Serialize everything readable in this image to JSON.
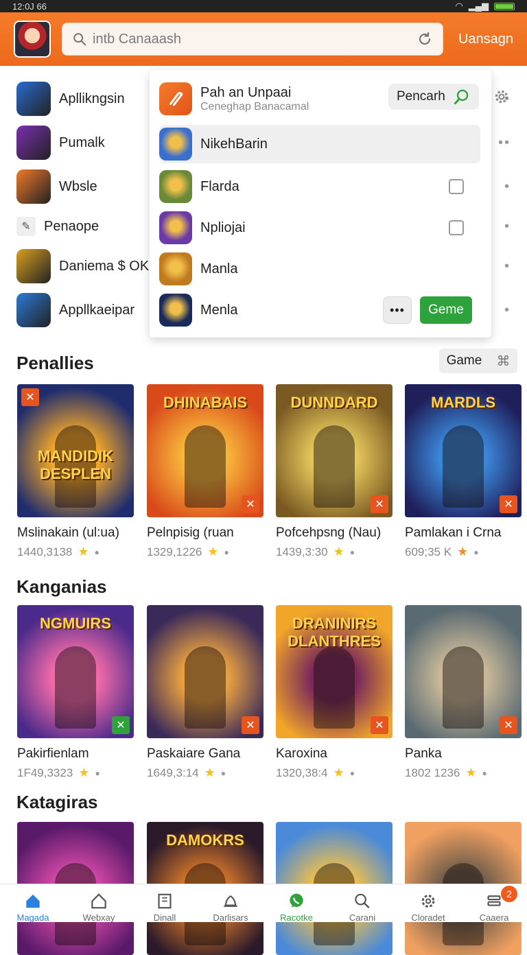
{
  "status": {
    "time": "12:0J 66"
  },
  "header": {
    "search_value": "intb Canaaash",
    "signin_label": "Uansagn"
  },
  "app_list": [
    {
      "label": "Apllikngsin",
      "icon": "wizard-app-icon",
      "color": "#2a6bd1"
    },
    {
      "label": "Pumalk",
      "icon": "game-app-icon",
      "color": "#7a2fb0"
    },
    {
      "label": "Wbsle",
      "icon": "mail-app-icon",
      "color": "#f07a2a"
    },
    {
      "label": "Penaope",
      "icon": "pencil-icon",
      "color": "#eeeeee"
    },
    {
      "label": "Daniema $ OK",
      "icon": "puzzle-app-icon",
      "color": "#d9a020"
    },
    {
      "label": "Appllkaeipar",
      "icon": "chat-app-icon",
      "color": "#2b7ad8"
    }
  ],
  "dropdown": {
    "top": {
      "title": "Pah an Unpaai",
      "subtitle": "Ceneghap Banacamal",
      "search_button": "Pencarh"
    },
    "rows": [
      {
        "label": "NikehBarin",
        "selected": true,
        "color": "#3a6fd0"
      },
      {
        "label": "Flarda",
        "checkbox": true,
        "color": "#6a8a3a"
      },
      {
        "label": "Npliojai",
        "checkbox": true,
        "color": "#6a3aa8"
      },
      {
        "label": "Manla",
        "color": "#c07a20"
      },
      {
        "label": "Menla",
        "color": "#1a2a5a",
        "more_label": "•••",
        "button": "Geme"
      }
    ]
  },
  "sections": [
    {
      "title": "Penallies",
      "chip": "Game",
      "cards": [
        {
          "name": "Mslinakain (ul:ua)",
          "meta": "1440,3138",
          "art": "MANDIDIK DESPLEN",
          "c1": "#1f2d6e",
          "c2": "#f2a629",
          "badge": "#e6551f"
        },
        {
          "name": "Pelnpisig (ruan",
          "meta": "1329,1226",
          "art": "DHINABAIS",
          "c1": "#d84a1a",
          "c2": "#f7b43a",
          "badge": "#e6551f"
        },
        {
          "name": "Pofcehpsng (Nau)",
          "meta": "1439,3:30",
          "art": "DUNNDARD",
          "c1": "#7a5a22",
          "c2": "#e2c45a",
          "badge": "#e6551f"
        },
        {
          "name": "Pamlakan i Crna",
          "meta": "609;35 K",
          "art": "MARDLS",
          "c1": "#1f1f5a",
          "c2": "#3a86d8",
          "badge": "#e6551f"
        }
      ]
    },
    {
      "title": "Kanganias",
      "cards": [
        {
          "name": "Pakirfienlam",
          "meta": "1F49,3323",
          "art": "NGMUIRS",
          "c1": "#4a2a8a",
          "c2": "#f06aa8",
          "badge": "#2fa33b"
        },
        {
          "name": "Paskaiare Gana",
          "meta": "1649,3:14",
          "art": "",
          "c1": "#3a2a5a",
          "c2": "#e8a040",
          "badge": "#e6551f"
        },
        {
          "name": "Karoxina",
          "meta": "1320,38:4",
          "art": "DRANINIRS DLANTHRES",
          "c1": "#f2a629",
          "c2": "#7a2a5a",
          "badge": "#e6551f"
        },
        {
          "name": "Panka",
          "meta": "1802 1236",
          "art": "",
          "c1": "#5a6a72",
          "c2": "#c8b898",
          "badge": "#e6551f"
        }
      ]
    },
    {
      "title": "Katagiras",
      "cards": [
        {
          "name": "",
          "meta": "",
          "art": "",
          "c1": "#5a1a6a",
          "c2": "#d84aa8",
          "badge": ""
        },
        {
          "name": "",
          "meta": "",
          "art": "DAMOKRS",
          "c1": "#2a1a2a",
          "c2": "#d8782a",
          "badge": ""
        },
        {
          "name": "",
          "meta": "",
          "art": "",
          "c1": "#4a8ad8",
          "c2": "#f2c04a",
          "badge": ""
        },
        {
          "name": "",
          "meta": "",
          "art": "",
          "c1": "#f0a060",
          "c2": "#6a5a4a",
          "badge": ""
        }
      ]
    }
  ],
  "bottom_nav": [
    {
      "label": "Magada",
      "icon": "home-icon",
      "active": true
    },
    {
      "label": "Webxay",
      "icon": "house-outline-icon"
    },
    {
      "label": "Dinall",
      "icon": "book-icon"
    },
    {
      "label": "Darlisars",
      "icon": "bell-icon"
    },
    {
      "label": "Racotke",
      "icon": "whatsapp-icon",
      "wa": true
    },
    {
      "label": "Carani",
      "icon": "search-icon"
    },
    {
      "label": "Cloradet",
      "icon": "gear-icon"
    },
    {
      "label": "Caaera",
      "icon": "layers-icon",
      "badge": "2"
    }
  ],
  "colors": {
    "brand_orange": "#ee6f20",
    "green": "#2fa33b",
    "active_blue": "#2d7fe0"
  }
}
